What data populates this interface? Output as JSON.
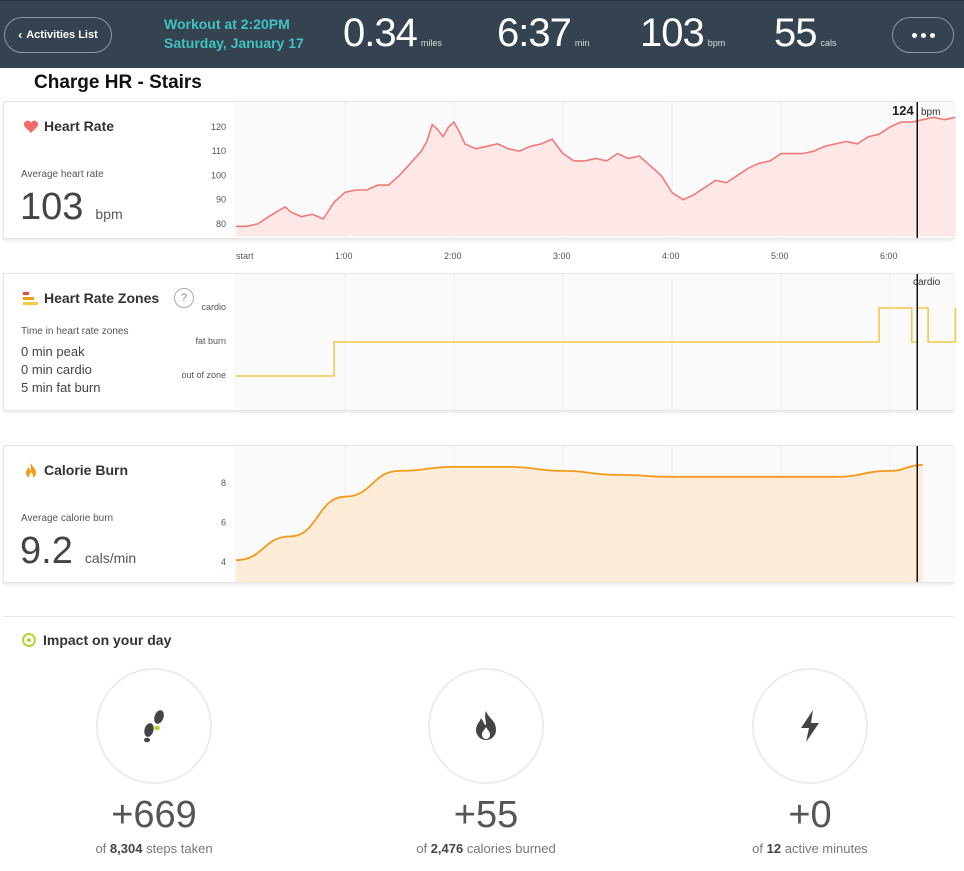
{
  "header": {
    "back_label": "Activities List",
    "workout_time": "Workout at 2:20PM",
    "workout_date": "Saturday, January 17",
    "stats": [
      {
        "value": "0.34",
        "unit": "miles"
      },
      {
        "value": "6:37",
        "unit": "min"
      },
      {
        "value": "103",
        "unit": "bpm"
      },
      {
        "value": "55",
        "unit": "cals"
      }
    ],
    "more_icon": "ellipsis-icon"
  },
  "page_title": "Charge HR - Stairs",
  "heart_rate": {
    "title": "Heart Rate",
    "icon": "heart-icon",
    "avg_label": "Average heart rate",
    "avg_value": "103",
    "avg_unit": "bpm",
    "cursor_value": "124",
    "cursor_unit": "bpm",
    "color": "#f07a7a"
  },
  "zones": {
    "title": "Heart Rate Zones",
    "icon": "zones-icon",
    "help": "?",
    "label": "Time in heart rate zones",
    "lines": [
      "0 min peak",
      "0 min cardio",
      "5 min fat burn"
    ],
    "zone_labels": [
      "cardio",
      "fat burn",
      "out of zone"
    ],
    "cursor_label": "cardio",
    "color": "#f4c84a"
  },
  "calories": {
    "title": "Calorie Burn",
    "icon": "flame-icon",
    "avg_label": "Average calorie burn",
    "avg_value": "9.2",
    "avg_unit": "cals/min",
    "color": "#f49a1a"
  },
  "time_axis": [
    "start",
    "1:00",
    "2:00",
    "3:00",
    "4:00",
    "5:00",
    "6:00"
  ],
  "impact": {
    "title": "Impact on your day",
    "items": [
      {
        "icon": "footsteps-icon",
        "delta": "+669",
        "pre": "of ",
        "bold": "8,304",
        "post": " steps taken"
      },
      {
        "icon": "flame-icon",
        "delta": "+55",
        "pre": "of ",
        "bold": "2,476",
        "post": " calories burned"
      },
      {
        "icon": "lightning-icon",
        "delta": "+0",
        "pre": "of ",
        "bold": "12",
        "post": " active minutes"
      }
    ]
  },
  "chart_data": [
    {
      "type": "line",
      "title": "Heart Rate",
      "x": [
        0.0,
        0.1,
        0.2,
        0.3,
        0.45,
        0.5,
        0.6,
        0.7,
        0.8,
        0.9,
        1.0,
        1.1,
        1.2,
        1.3,
        1.4,
        1.5,
        1.6,
        1.7,
        1.75,
        1.8,
        1.85,
        1.9,
        1.95,
        2.0,
        2.05,
        2.1,
        2.2,
        2.3,
        2.4,
        2.5,
        2.6,
        2.7,
        2.8,
        2.9,
        3.0,
        3.1,
        3.2,
        3.3,
        3.4,
        3.5,
        3.6,
        3.7,
        3.8,
        3.9,
        4.0,
        4.1,
        4.2,
        4.3,
        4.4,
        4.5,
        4.6,
        4.7,
        4.8,
        4.9,
        5.0,
        5.1,
        5.2,
        5.3,
        5.4,
        5.5,
        5.6,
        5.7,
        5.8,
        5.9,
        6.0,
        6.1,
        6.2,
        6.3,
        6.4,
        6.5,
        6.6
      ],
      "y": [
        79,
        79,
        80,
        83,
        87,
        85,
        83,
        84,
        82,
        89,
        93,
        94,
        94,
        96,
        96,
        100,
        105,
        110,
        114,
        121,
        119,
        116,
        120,
        122,
        118,
        113,
        111,
        112,
        113,
        111,
        110,
        112,
        113,
        115,
        109,
        106,
        106,
        107,
        106,
        109,
        107,
        108,
        104,
        100,
        93,
        90,
        92,
        95,
        98,
        97,
        100,
        103,
        105,
        106,
        109,
        109,
        109,
        110,
        112,
        113,
        114,
        113,
        116,
        117,
        120,
        122,
        122,
        123,
        124,
        123,
        124
      ],
      "ylim": [
        75,
        127
      ],
      "yticks": [
        80,
        90,
        100,
        110,
        120
      ],
      "unit": "bpm"
    },
    {
      "type": "line",
      "title": "Heart Rate Zones",
      "categories": [
        "out of zone",
        "fat burn",
        "cardio"
      ],
      "x": [
        0.0,
        0.9,
        0.9,
        5.9,
        5.9,
        6.2,
        6.2,
        6.25,
        6.25,
        6.35,
        6.35,
        6.6,
        6.6
      ],
      "y": [
        0,
        0,
        1,
        1,
        2,
        2,
        1,
        1,
        2,
        2,
        1,
        1,
        2
      ]
    },
    {
      "type": "area",
      "title": "Calorie Burn",
      "x": [
        0.0,
        0.5,
        1.0,
        1.5,
        2.0,
        2.5,
        3.0,
        3.5,
        4.0,
        4.5,
        5.0,
        5.5,
        6.0,
        6.3
      ],
      "y": [
        4.1,
        5.3,
        7.3,
        8.6,
        8.8,
        8.8,
        8.6,
        8.4,
        8.3,
        8.3,
        8.3,
        8.3,
        8.6,
        8.9
      ],
      "ylim": [
        3,
        9.4
      ],
      "yticks": [
        4,
        6,
        8
      ],
      "unit": "cals/min"
    }
  ]
}
